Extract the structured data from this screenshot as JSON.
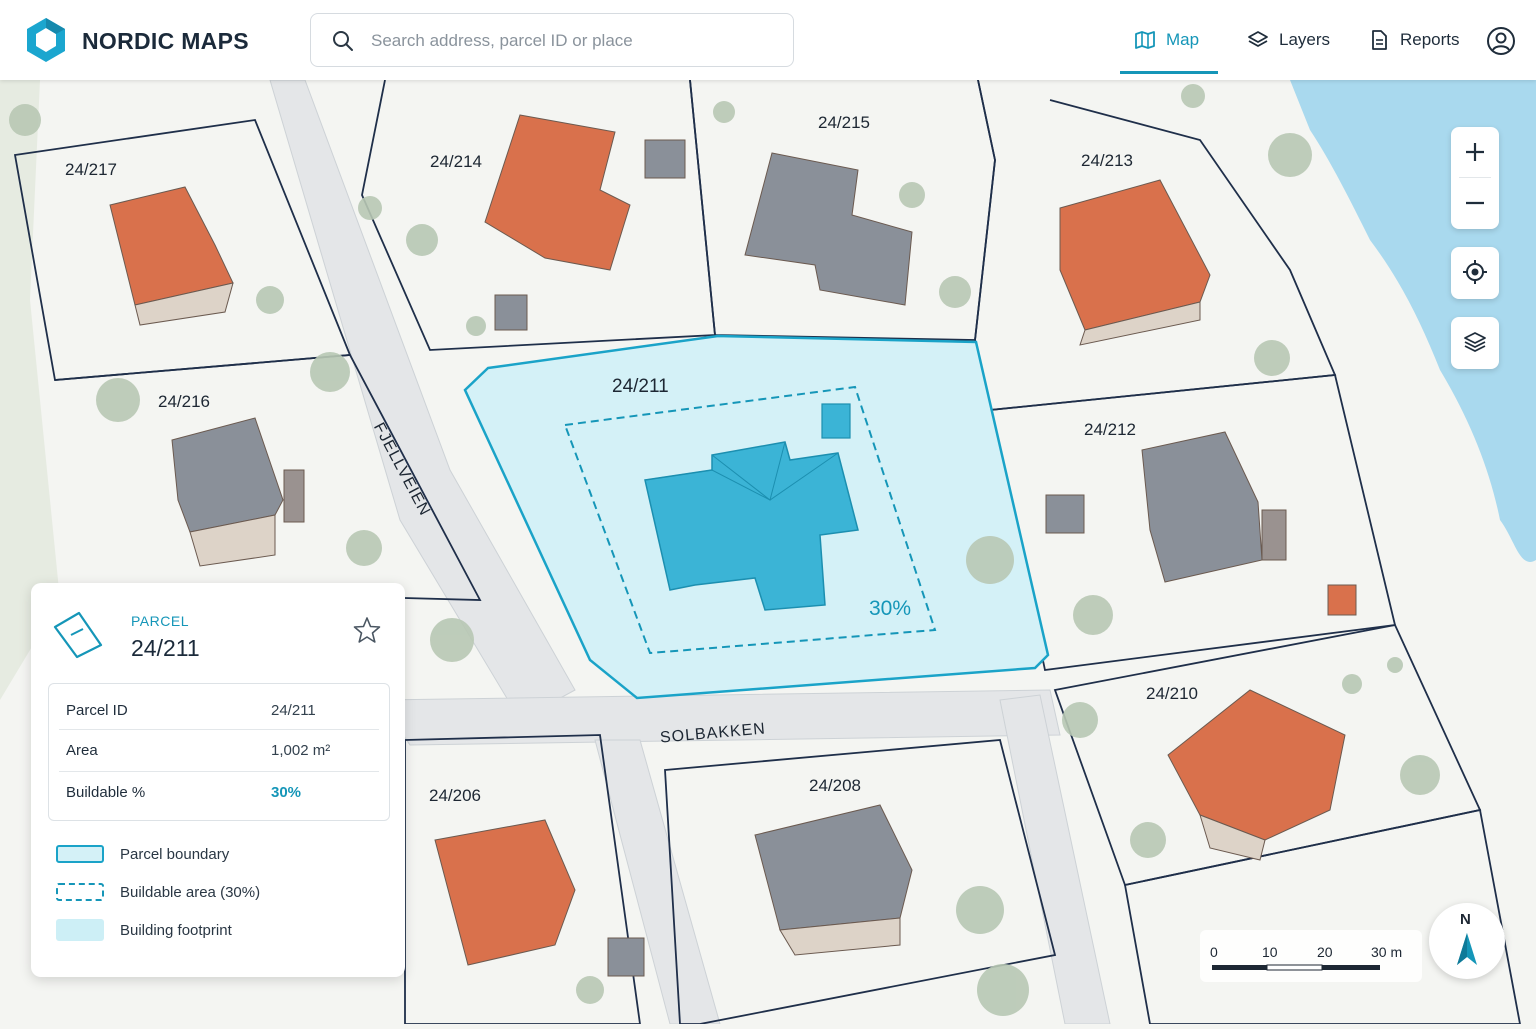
{
  "app": {
    "brand": "NORDIC MAPS"
  },
  "search": {
    "placeholder": "Search address, parcel ID or place"
  },
  "nav": {
    "map": "Map",
    "layers": "Layers",
    "reports": "Reports"
  },
  "map": {
    "parcels": [
      "24/217",
      "24/214",
      "24/215",
      "24/213",
      "24/216",
      "24/211",
      "24/212",
      "24/206",
      "24/208",
      "24/210"
    ],
    "roads": [
      "FJELLVEIEN",
      "SOLBAKKEN"
    ],
    "buildable_overlay_label": "30%",
    "selected_parcel": "24/211"
  },
  "controls": {
    "zoom_in": "+",
    "zoom_out": "−"
  },
  "panel": {
    "kicker": "PARCEL",
    "title": "24/211",
    "rows": [
      {
        "key": "Parcel ID",
        "value": "24/211"
      },
      {
        "key": "Area",
        "value": "1,002 m²"
      },
      {
        "key": "Buildable %",
        "value": "30%"
      }
    ],
    "legend": [
      "Parcel boundary",
      "Buildable area (30%)",
      "Building footprint"
    ]
  },
  "scale": {
    "ticks": [
      "0",
      "10",
      "20",
      "30 m"
    ]
  },
  "compass": {
    "north": "N"
  },
  "colors": {
    "accent": "#1596b8",
    "selection_fill": "#d4f1f7",
    "footprint": "#3bb4d6",
    "roof_orange": "#d9714c",
    "roof_gray": "#8a9099",
    "water": "#a9d9ee",
    "boundary": "#1f2f4a"
  }
}
